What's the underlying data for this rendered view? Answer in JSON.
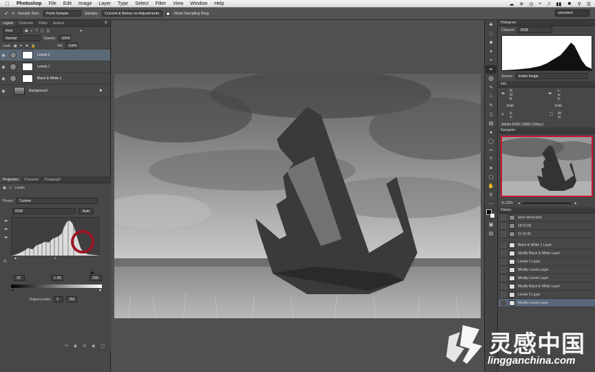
{
  "menubar": {
    "app": "Photoshop",
    "items": [
      "File",
      "Edit",
      "Image",
      "Layer",
      "Type",
      "Select",
      "Filter",
      "View",
      "Window",
      "Help"
    ]
  },
  "options": {
    "sample_size_label": "Sample Size:",
    "sample_size_value": "Point Sample",
    "sample_label": "Sample:",
    "sample_value": "Current & Below no Adjustments",
    "show_ring_label": "Show Sampling Ring",
    "workspace": "standard"
  },
  "layers_panel": {
    "tabs": [
      "Layers",
      "Channels",
      "Paths",
      "Actions"
    ],
    "kind_label": "Kind",
    "blend_mode": "Normal",
    "opacity_label": "Opacity:",
    "opacity_value": "100%",
    "lock_label": "Lock:",
    "fill_label": "Fill:",
    "fill_value": "100%",
    "layers": [
      {
        "name": "Levels 2"
      },
      {
        "name": "Levels 1"
      },
      {
        "name": "Black & White 1"
      },
      {
        "name": "Background"
      }
    ]
  },
  "properties_panel": {
    "tabs": [
      "Properties",
      "Character",
      "Paragraph"
    ],
    "adjustment_title": "Levels",
    "preset_label": "Preset:",
    "preset_value": "Custom",
    "channel_value": "RGB",
    "auto_label": "Auto",
    "input_black": "22",
    "input_gamma": "1.00",
    "input_white": "235",
    "output_label": "Output Levels:",
    "output_black": "0",
    "output_white": "255"
  },
  "histogram_panel": {
    "title": "Histogram",
    "channel_label": "Channel:",
    "channel_value": "RGB",
    "source_label": "Source:",
    "source_value": "Entire Image"
  },
  "info_panel": {
    "title": "Info",
    "left_labels": [
      "R:",
      "G:",
      "B:"
    ],
    "right_labels": [
      "L:",
      "a:",
      "b:"
    ],
    "bit_left": "8-bit",
    "bit_right": "8-bit",
    "xy_left": [
      "X:",
      "Y:"
    ],
    "wh_right": [
      "W:",
      "H:"
    ],
    "profile": "Adobe RGB (1998) (16bpc)"
  },
  "navigator_panel": {
    "title": "Navigator",
    "zoom": "11.22%"
  },
  "history_panel": {
    "title": "History",
    "snapshot_doc": "wyre wreck.psd",
    "snapshots": [
      "18:01:56",
      "11:13:42"
    ],
    "items": [
      "Black & White 1 Layer",
      "Modify Black & White Layer",
      "Levels 1 Layer",
      "Modify Levels Layer",
      "Modify Levels Layer",
      "Modify Black & White Layer",
      "Levels 2 Layer",
      "Modify Levels Layer"
    ]
  },
  "watermark": {
    "cn": "灵感中国",
    "url": "lingganchina.com"
  },
  "colors": {
    "accent_red": "#9d1424",
    "selection_blue": "#5c6a78"
  }
}
